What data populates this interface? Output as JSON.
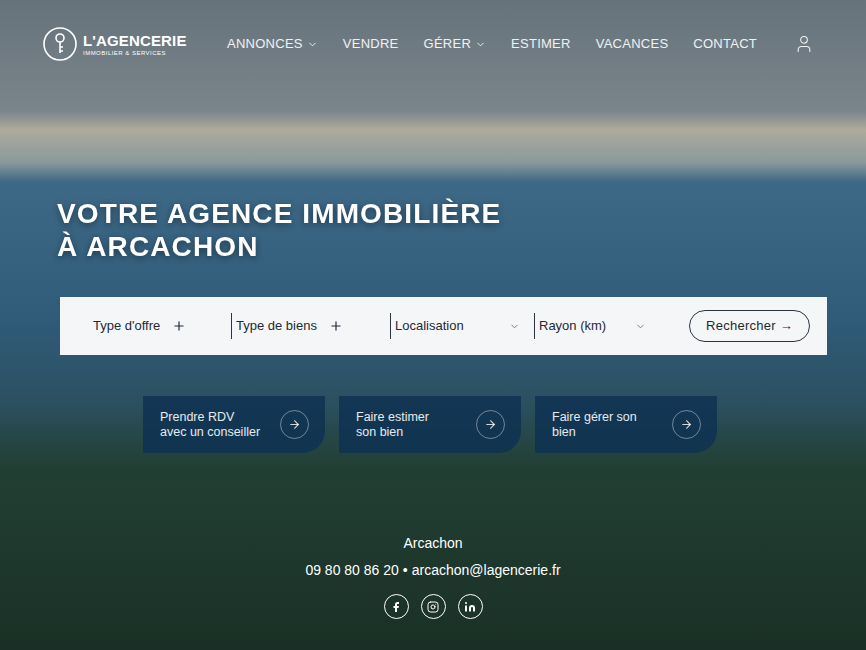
{
  "logo": {
    "name": "L'AGENCERIE",
    "tagline": "IMMOBILIER & SERVICES"
  },
  "nav": [
    {
      "label": "ANNONCES",
      "dropdown": true
    },
    {
      "label": "VENDRE",
      "dropdown": false
    },
    {
      "label": "GÉRER",
      "dropdown": true
    },
    {
      "label": "ESTIMER",
      "dropdown": false
    },
    {
      "label": "VACANCES",
      "dropdown": false
    },
    {
      "label": "CONTACT",
      "dropdown": false
    }
  ],
  "hero": {
    "title_lines": [
      "VOTRE AGENCE IMMOBILIÈRE",
      "À ARCACHON"
    ]
  },
  "search": {
    "fields": [
      {
        "label": "Type d'offre",
        "kind": "plus"
      },
      {
        "label": "Type de biens",
        "kind": "plus"
      },
      {
        "label": "Localisation",
        "kind": "select"
      },
      {
        "label": "Rayon (km)",
        "kind": "select"
      }
    ],
    "button": "Rechercher →"
  },
  "actions": [
    {
      "lines": [
        "Prendre RDV",
        "avec un conseiller"
      ]
    },
    {
      "lines": [
        "Faire estimer",
        "son bien"
      ]
    },
    {
      "lines": [
        "Faire gérer son",
        "bien"
      ]
    }
  ],
  "contact": {
    "city": "Arcachon",
    "phone": "09 80 80 86 20",
    "separator": "•",
    "email": "arcachon@lagencerie.fr"
  }
}
